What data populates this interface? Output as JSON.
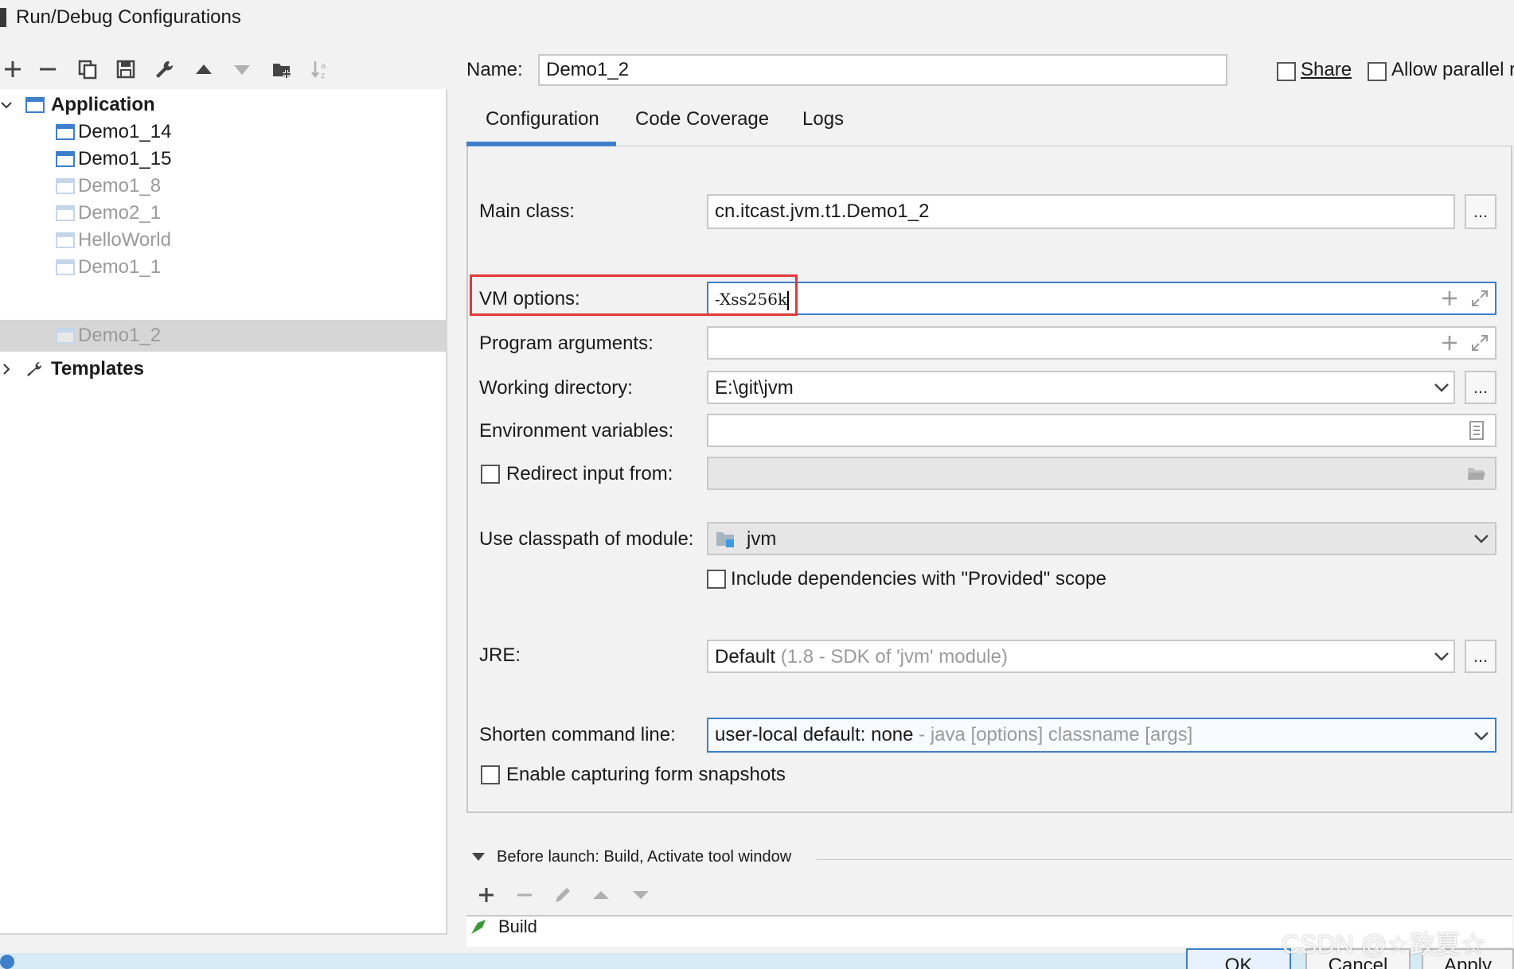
{
  "window": {
    "title": "Run/Debug Configurations"
  },
  "toolbar": {
    "buttons": [
      "add-icon",
      "remove-icon",
      "copy-icon",
      "save-icon",
      "wrench-icon",
      "move-up-icon",
      "move-down-icon",
      "folder-add-icon",
      "sort-icon"
    ]
  },
  "tree": {
    "application_label": "Application",
    "items": [
      {
        "label": "Demo1_14",
        "dim": false
      },
      {
        "label": "Demo1_15",
        "dim": false
      },
      {
        "label": "Demo1_8",
        "dim": true
      },
      {
        "label": "Demo2_1",
        "dim": true
      },
      {
        "label": "HelloWorld",
        "dim": true
      },
      {
        "label": "Demo1_1",
        "dim": true
      },
      {
        "label": "Demo1_2",
        "dim": true,
        "selected": true
      }
    ],
    "templates_label": "Templates"
  },
  "header": {
    "name_label": "Name:",
    "name_value": "Demo1_2",
    "share_label": "Share",
    "allow_parallel_label": "Allow parallel ru"
  },
  "tabs": [
    {
      "label": "Configuration",
      "active": true
    },
    {
      "label": "Code Coverage",
      "active": false
    },
    {
      "label": "Logs",
      "active": false
    }
  ],
  "config": {
    "main_class_label": "Main class:",
    "main_class_value": "cn.itcast.jvm.t1.Demo1_2",
    "vm_options_label": "VM options:",
    "vm_options_value": "-Xss256k",
    "program_args_label": "Program arguments:",
    "working_dir_label": "Working directory:",
    "working_dir_value": "E:\\git\\jvm",
    "env_vars_label": "Environment variables:",
    "redirect_label": "Redirect input from:",
    "classpath_label": "Use classpath of module:",
    "classpath_value": "jvm",
    "include_deps_label": "Include dependencies with \"Provided\" scope",
    "jre_label": "JRE:",
    "jre_value": "Default",
    "jre_hint": "(1.8 - SDK of 'jvm' module)",
    "shorten_label": "Shorten command line:",
    "shorten_value": "user-local default: none",
    "shorten_hint": "- java [options] classname [args]",
    "capture_label": "Enable capturing form snapshots",
    "ellipsis": "..."
  },
  "before_launch": {
    "label": "Before launch: Build, Activate tool window",
    "build_item": "Build"
  },
  "buttons": {
    "ok": "OK",
    "cancel": "Cancel",
    "apply": "Apply"
  },
  "watermark": "CSDN @☆致夏☆",
  "colors": {
    "accent": "#3f7ec9",
    "highlight": "#e03a3a",
    "selected_row": "#d6d6d6"
  }
}
